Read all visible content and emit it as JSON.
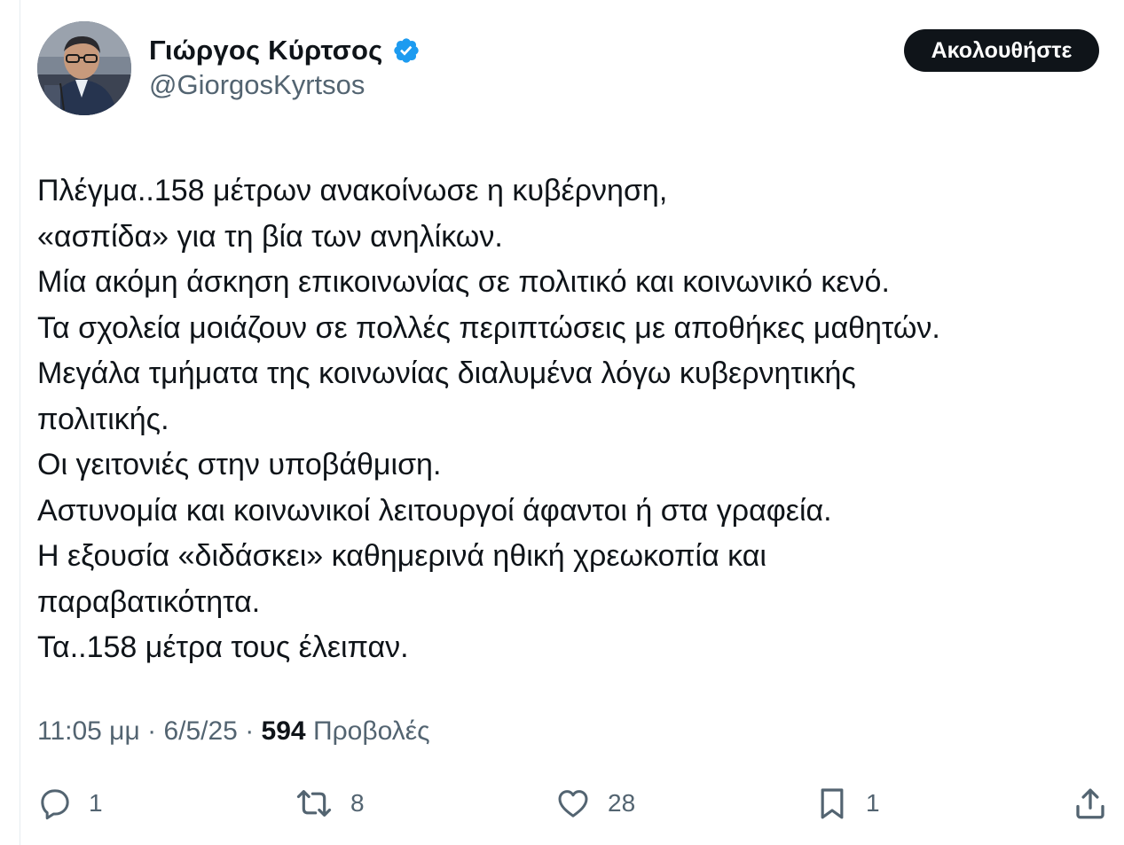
{
  "author": {
    "display_name": "Γιώργος Κύρτσος",
    "handle": "@GiorgosKyrtsos",
    "verified": true,
    "verified_color": "#1d9bf0"
  },
  "follow_button": {
    "label": "Ακολουθήστε"
  },
  "tweet": {
    "lines": [
      "Πλέγμα..158 μέτρων ανακοίνωσε η κυβέρνηση,",
      "«ασπίδα» για τη βία των ανηλίκων.",
      "Μία ακόμη άσκηση επικοινωνίας σε πολιτικό και κοινωνικό κενό.",
      "Τα σχολεία μοιάζουν σε πολλές περιπτώσεις με αποθήκες μαθητών.",
      "Μεγάλα τμήματα της κοινωνίας διαλυμένα λόγω κυβερνητικής",
      "πολιτικής.",
      "Οι γειτονιές στην υποβάθμιση.",
      "Αστυνομία και κοινωνικοί λειτουργοί άφαντοι ή στα γραφεία.",
      "Η εξουσία «διδάσκει» καθημερινά ηθική χρεωκοπία και",
      "παραβατικότητα.",
      "Τα..158 μέτρα τους έλειπαν."
    ]
  },
  "meta": {
    "time": "11:05 μμ",
    "separator": " · ",
    "date": "6/5/25",
    "views_count": "594",
    "views_label": "Προβολές"
  },
  "actions": {
    "reply": {
      "icon": "reply-icon",
      "count": "1"
    },
    "retweet": {
      "icon": "retweet-icon",
      "count": "8"
    },
    "like": {
      "icon": "heart-icon",
      "count": "28"
    },
    "bookmark": {
      "icon": "bookmark-icon",
      "count": "1"
    },
    "share": {
      "icon": "share-icon"
    }
  },
  "colors": {
    "text_primary": "#0f1419",
    "text_secondary": "#536471",
    "button_bg": "#0f1419",
    "button_text": "#ffffff"
  }
}
